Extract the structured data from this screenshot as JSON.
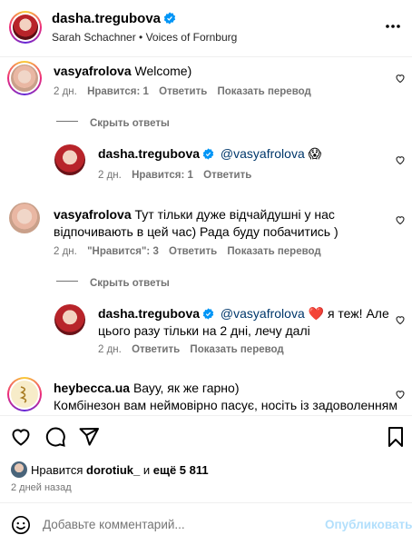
{
  "header": {
    "username": "dasha.tregubova",
    "subtitle": "Sarah Schachner • Voices of Fornburg",
    "more_label": "..."
  },
  "comments": [
    {
      "username": "vasyafrolova",
      "text": "Welcome)",
      "time": "2 дн.",
      "likes": "Нравится: 1",
      "reply": "Ответить",
      "translate": "Показать перевод",
      "hide_replies": "Скрыть ответы",
      "replies": [
        {
          "username": "dasha.tregubova",
          "mention": "@vasyafrolova",
          "emoji": "😱",
          "time": "2 дн.",
          "likes": "Нравится: 1",
          "reply": "Ответить"
        }
      ]
    },
    {
      "username": "vasyafrolova",
      "text_line1": "Тут тільки дуже відчайдушні у нас",
      "text_line2": "відпочивають в цей час) Рада буду побачитись )",
      "time": "2 дн.",
      "likes": "\"Нравится\": 3",
      "reply": "Ответить",
      "translate": "Показать перевод",
      "hide_replies": "Скрыть ответы",
      "replies": [
        {
          "username": "dasha.tregubova",
          "mention": "@vasyafrolova",
          "emoji": "❤️",
          "text_line1": "я теж! Але",
          "text_line2": "цього разу тільки на 2 дні, лечу далі",
          "time": "2 дн.",
          "reply": "Ответить",
          "translate": "Показать перевод"
        }
      ]
    },
    {
      "username": "heybecca.ua",
      "text_line1": "Вауу, як же гарно)",
      "text_line2": "Комбінезон вам неймовірно пасує, носіть із задоволенням"
    }
  ],
  "actions": {
    "likes_prefix": "Нравится",
    "likes_user": "dorotiuk_",
    "likes_and": "и",
    "likes_more": "ещё 5 811",
    "date": "2 дней назад"
  },
  "compose": {
    "placeholder": "Добавьте комментарий...",
    "publish_label": "Опубликовать"
  },
  "colors": {
    "meta": "#737373",
    "mention": "#00376b",
    "publish": "#b2dffc",
    "verified": "#0095f6"
  }
}
